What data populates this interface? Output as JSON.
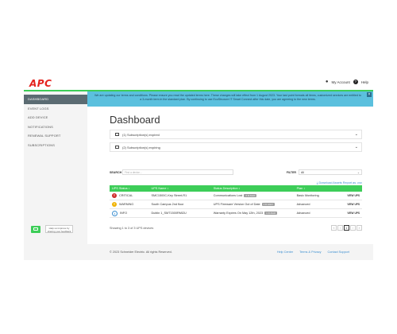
{
  "app": {
    "logo": "APC",
    "my_account": "My Account",
    "help": "Help"
  },
  "banner": {
    "text": "We are updating our terms and conditions. Please ensure you read the updated terms here. These changes will take effect from 1 August 2023. Your last point formats all items, customized services are entitled to a 3-month term in the standard plan. By continuing to use EcoStruxure IT Smart Connect after this date, you are agreeing to the new terms.",
    "close": "×"
  },
  "sidebar": {
    "items": [
      {
        "label": "DASHBOARD"
      },
      {
        "label": "EVENT LOGS"
      },
      {
        "label": "ADD DEVICE"
      },
      {
        "label": "NOTIFICATIONS"
      },
      {
        "label": "RENEWAL SUPPORT"
      },
      {
        "label": "SUBSCRIPTIONS"
      }
    ],
    "feedback_tip": "Help us improve by sharing your feedback"
  },
  "main": {
    "title": "Dashboard",
    "subscriptions": [
      {
        "label": "(1) Subscription(s) expired"
      },
      {
        "label": "(2) Subscription(s) expiring"
      }
    ],
    "search_label": "SEARCH",
    "search_placeholder": "Find a device...",
    "filter_label": "FILTER",
    "filter_value": "All",
    "download_link": "Download Assets Report as .csv",
    "columns": [
      "UPS Status",
      "UPS Name",
      "Status Description",
      "Plan",
      ""
    ],
    "rows": [
      {
        "status": "CRITICAL",
        "status_icon": "critical-icon",
        "name": "SMC1500C-Key Street-R1",
        "description": "Communications Lost",
        "tag": "2 D AGO",
        "plan": "Basic Monitoring",
        "action": "VIEW UPS"
      },
      {
        "status": "WARNING",
        "status_icon": "warning-icon",
        "name": "South Campus 2nd floor",
        "description": "UPS Firmware Version Out of Date",
        "tag": "1 D AGO",
        "plan": "Advanced",
        "action": "VIEW UPS"
      },
      {
        "status": "INFO",
        "status_icon": "info-icon",
        "name": "Dublin 1_SMT1500RMI2U",
        "description": "Warranty Expires On May 12th, 2023",
        "tag": "1 D AGO",
        "plan": "Advanced",
        "action": "VIEW UPS"
      }
    ],
    "showing": "Showing 1 to 3 of 3 UPS devices",
    "pager": [
      "«",
      "‹",
      "1",
      "›",
      "»"
    ]
  },
  "footer": {
    "copyright": "© 2023 Schneider Electric. All rights Reserved.",
    "links": [
      "Help Center",
      "Terms & Privacy",
      "Contact Support"
    ]
  },
  "colors": {
    "accent": "#3dcd58",
    "banner": "#5bc0de",
    "brand": "#e4231e"
  }
}
